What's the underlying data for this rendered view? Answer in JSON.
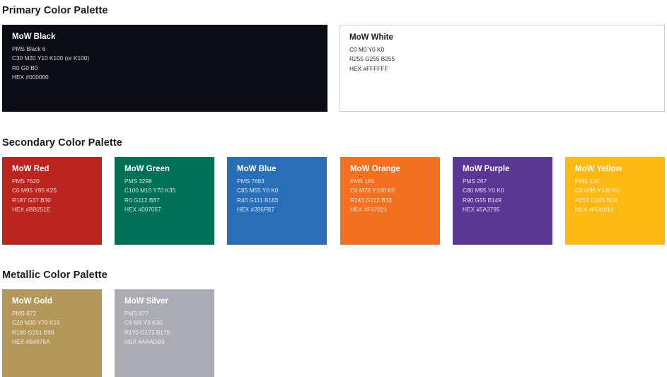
{
  "sections": {
    "primary": {
      "title": "Primary Color Palette"
    },
    "secondary": {
      "title": "Secondary Color Palette"
    },
    "metallic": {
      "title": "Metallic Color Palette"
    }
  },
  "swatches": {
    "black": {
      "name": "MoW Black",
      "specs": [
        "PMS Black 6",
        "C30 M20 Y10 K100 (or K100)",
        "R0 G0 B0",
        "HEX #000000"
      ],
      "color": "#0b0d16"
    },
    "white": {
      "name": "MoW White",
      "specs": [
        "C0 M0 Y0 K0",
        "R255 G255 B255",
        "HEX #FFFFFF"
      ],
      "color": "#ffffff",
      "border": "#cfcfcf"
    },
    "red": {
      "name": "MoW Red",
      "specs": [
        "PMS 7620",
        "C0 M95 Y95 K25",
        "R187 G37 B30",
        "HEX #BB251E"
      ],
      "color": "#bb251e"
    },
    "green": {
      "name": "MoW Green",
      "specs": [
        "PMS 3298",
        "C100 M10 Y70 K35",
        "R0 G112 B87",
        "HEX #007057"
      ],
      "color": "#007057"
    },
    "blue": {
      "name": "MoW Blue",
      "specs": [
        "PMS 7683",
        "C85 M55 Y0 K0",
        "R40 G111 B183",
        "HEX #286FB7"
      ],
      "color": "#286fb7"
    },
    "orange": {
      "name": "MoW Orange",
      "specs": [
        "PMS 165",
        "C0 M70 Y100 K0",
        "R243 G112 B33",
        "HEX #F37021"
      ],
      "color": "#f37021"
    },
    "purple": {
      "name": "MoW Purple",
      "specs": [
        "PMS 267",
        "C80 M95 Y0 K0",
        "R90 G55 B149",
        "HEX #5A3795"
      ],
      "color": "#5a3795"
    },
    "yellow": {
      "name": "MoW Yellow",
      "specs": [
        "PMS 130",
        "C0 M30 Y100 K0",
        "R253 G185 B19",
        "HEX #FDB913"
      ],
      "color": "#fdb913"
    },
    "gold": {
      "name": "MoW Gold",
      "specs": [
        "PMS 872",
        "C20 M30 Y70 K15",
        "R180 G151 B90",
        "HEX #B4975A"
      ],
      "color": "#b4975a"
    },
    "silver": {
      "name": "MoW Silver",
      "specs": [
        "PMS 877",
        "C9 M6 Y3 K30",
        "R170 G173 B179",
        "HEX #AAADB3"
      ],
      "color": "#aaadb3"
    }
  }
}
